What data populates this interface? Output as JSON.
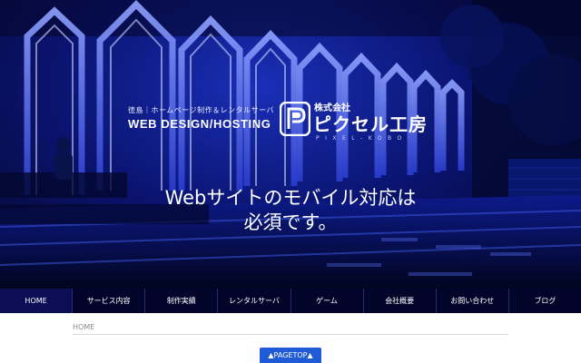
{
  "brand": {
    "tagline_sub": "徳島｜ホームページ制作＆レンタルサーバ",
    "tagline_main": "WEB DESIGN/HOSTING",
    "logo_corp": "株式会社",
    "logo_name": "ピクセル工房",
    "logo_roman": "PIXEL-KOBO"
  },
  "hero": {
    "headline_line1": "Webサイトのモバイル対応は",
    "headline_line2": "必須です。"
  },
  "nav": {
    "items": [
      {
        "label": "HOME"
      },
      {
        "label": "サービス内容"
      },
      {
        "label": "制作実績"
      },
      {
        "label": "レンタルサーバ"
      },
      {
        "label": "ゲーム"
      },
      {
        "label": "会社概要"
      },
      {
        "label": "お問い合わせ"
      },
      {
        "label": "ブログ"
      }
    ],
    "active_index": 0
  },
  "breadcrumb": {
    "current": "HOME"
  },
  "pagetop": {
    "label": "▲PAGETOP▲"
  },
  "colors": {
    "nav_bg": "#03042a",
    "pagetop_bg": "#1f5bd6",
    "hero_blue": "#1a2fb8"
  }
}
